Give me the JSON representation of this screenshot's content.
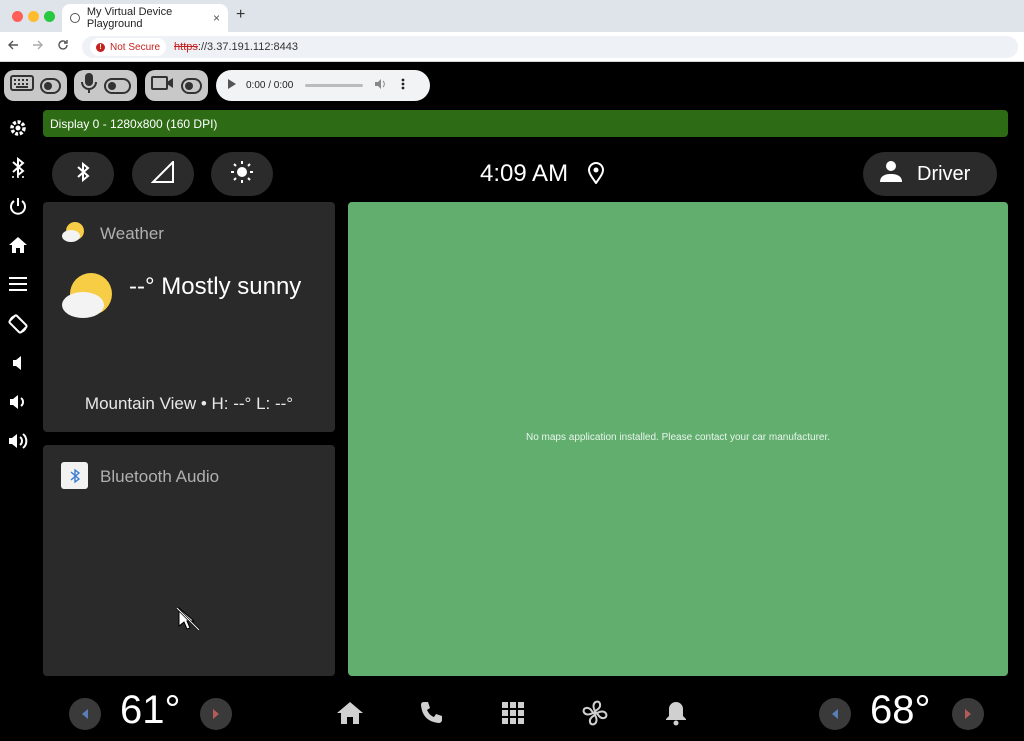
{
  "browser": {
    "tab_title": "My Virtual Device Playground",
    "close_tab": "×",
    "new_tab": "+",
    "security_label": "Not Secure",
    "url_scheme": "https",
    "url_rest": "://3.37.191.112:8443"
  },
  "toolbar": {
    "audio_time": "0:00 / 0:00"
  },
  "display": {
    "banner": "Display 0 - 1280x800 (160 DPI)"
  },
  "status": {
    "time": "4:09 AM",
    "user": "Driver"
  },
  "weather": {
    "title": "Weather",
    "condition": "--° Mostly sunny",
    "details": "Mountain View • H: --° L: --°"
  },
  "bluetooth": {
    "title": "Bluetooth Audio"
  },
  "map": {
    "message": "No maps application installed. Please contact your car manufacturer."
  },
  "climate": {
    "left_temp": "61°",
    "right_temp": "68°"
  },
  "colors": {
    "banner": "#2e6b15",
    "map": "#62ae6f",
    "card": "#2a2a2a"
  }
}
